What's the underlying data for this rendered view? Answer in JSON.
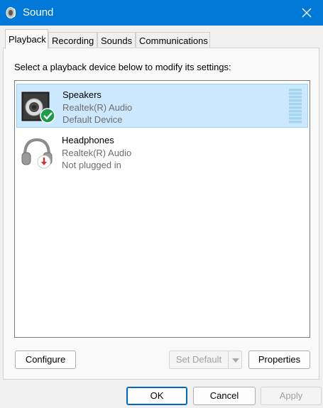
{
  "window": {
    "title": "Sound",
    "app_icon": "speaker-icon",
    "close_icon": "close-icon"
  },
  "tabs": [
    {
      "label": "Playback",
      "active": true
    },
    {
      "label": "Recording",
      "active": false
    },
    {
      "label": "Sounds",
      "active": false
    },
    {
      "label": "Communications",
      "active": false
    }
  ],
  "playback": {
    "instruction": "Select a playback device below to modify its settings:",
    "devices": [
      {
        "name": "Speakers",
        "driver": "Realtek(R) Audio",
        "status": "Default Device",
        "selected": true,
        "icon": "speakers-icon",
        "badge_icon": "checkmark-badge-icon",
        "badge_color": "#1e9b48"
      },
      {
        "name": "Headphones",
        "driver": "Realtek(R) Audio",
        "status": "Not plugged in",
        "selected": false,
        "icon": "headphones-icon",
        "badge_icon": "down-arrow-badge-icon",
        "badge_color": "#d42b2b"
      }
    ]
  },
  "buttons": {
    "configure": "Configure",
    "set_default": "Set Default",
    "properties": "Properties",
    "ok": "OK",
    "cancel": "Cancel",
    "apply": "Apply"
  },
  "colors": {
    "titlebar": "#0078d7",
    "selection_bg": "#cce8ff",
    "selection_border": "#99d1ff",
    "level_meter": "#a6d3f0",
    "default_button_border": "#0067c0"
  }
}
